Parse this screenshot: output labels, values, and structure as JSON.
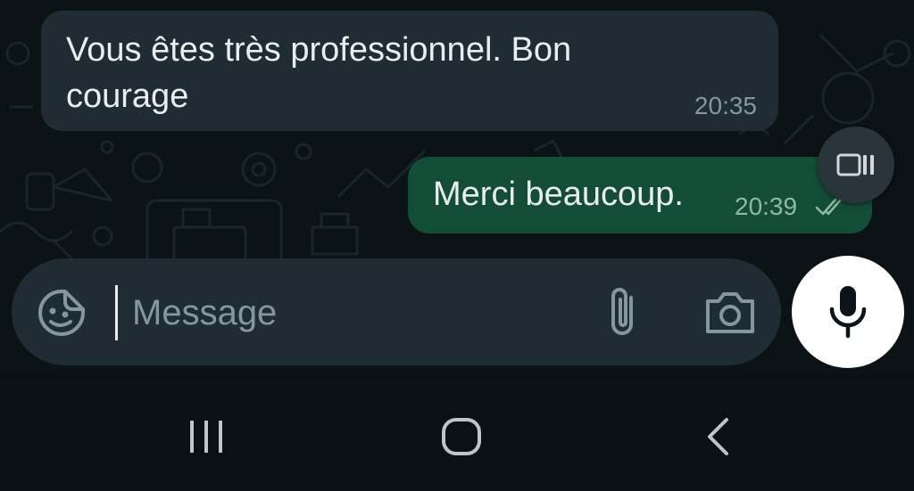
{
  "conversation": {
    "messages": [
      {
        "direction": "incoming",
        "text": "Vous êtes très professionnel. Bon courage",
        "time": "20:35"
      },
      {
        "direction": "outgoing",
        "text": "Merci beaucoup.",
        "time": "20:39",
        "status": "double-check-icon"
      }
    ]
  },
  "composer": {
    "placeholder": "Message",
    "value": "",
    "icons": {
      "emoji": "sticker-icon",
      "attach": "paperclip-icon",
      "camera": "camera-icon",
      "voice": "microphone-icon"
    }
  },
  "floating_action": {
    "icon": "video-speed-icon"
  },
  "system_nav": {
    "buttons": [
      "recents-icon",
      "home-icon",
      "back-icon"
    ]
  },
  "colors": {
    "chat_background": "#0c1317",
    "incoming_bubble": "#1f2c33",
    "outgoing_bubble": "#144d37",
    "composer": "#1f2c33",
    "nav_bar": "#0b1014"
  }
}
